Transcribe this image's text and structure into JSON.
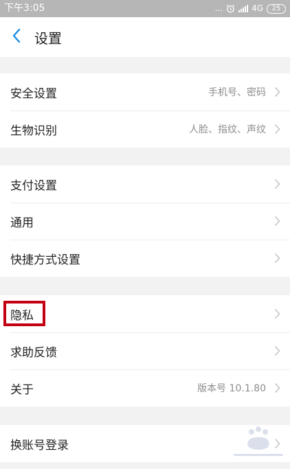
{
  "status_bar": {
    "time": "下午3:05",
    "dots": "...",
    "network": "4G",
    "battery": "25"
  },
  "header": {
    "title": "设置"
  },
  "groups": [
    {
      "items": [
        {
          "label": "安全设置",
          "detail": "手机号、密码"
        },
        {
          "label": "生物识别",
          "detail": "人脸、指纹、声纹"
        }
      ]
    },
    {
      "items": [
        {
          "label": "支付设置",
          "detail": ""
        },
        {
          "label": "通用",
          "detail": ""
        },
        {
          "label": "快捷方式设置",
          "detail": ""
        }
      ]
    },
    {
      "items": [
        {
          "label": "隐私",
          "detail": ""
        },
        {
          "label": "求助反馈",
          "detail": ""
        },
        {
          "label": "关于",
          "detail": "版本号 10.1.80"
        }
      ]
    },
    {
      "items": [
        {
          "label": "换账号登录",
          "detail": ""
        }
      ]
    }
  ],
  "colors": {
    "accent": "#1a8ee8",
    "highlight": "#c20012",
    "status_bar_bg": "#b6b6b6",
    "page_bg": "#f2f2f2"
  }
}
